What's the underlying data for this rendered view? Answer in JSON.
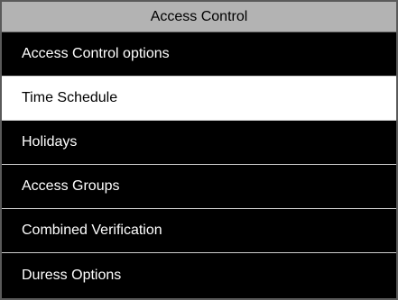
{
  "title": "Access Control",
  "selected_index": 1,
  "menu": {
    "items": [
      {
        "label": "Access Control options"
      },
      {
        "label": "Time Schedule"
      },
      {
        "label": "Holidays"
      },
      {
        "label": "Access Groups"
      },
      {
        "label": "Combined Verification"
      },
      {
        "label": "Duress Options"
      }
    ]
  },
  "colors": {
    "title_bar_bg": "#b3b3b3",
    "menu_bg": "#000000",
    "selected_bg": "#ffffff",
    "menu_text": "#ffffff",
    "selected_text": "#000000",
    "divider": "#cfcfcf"
  }
}
